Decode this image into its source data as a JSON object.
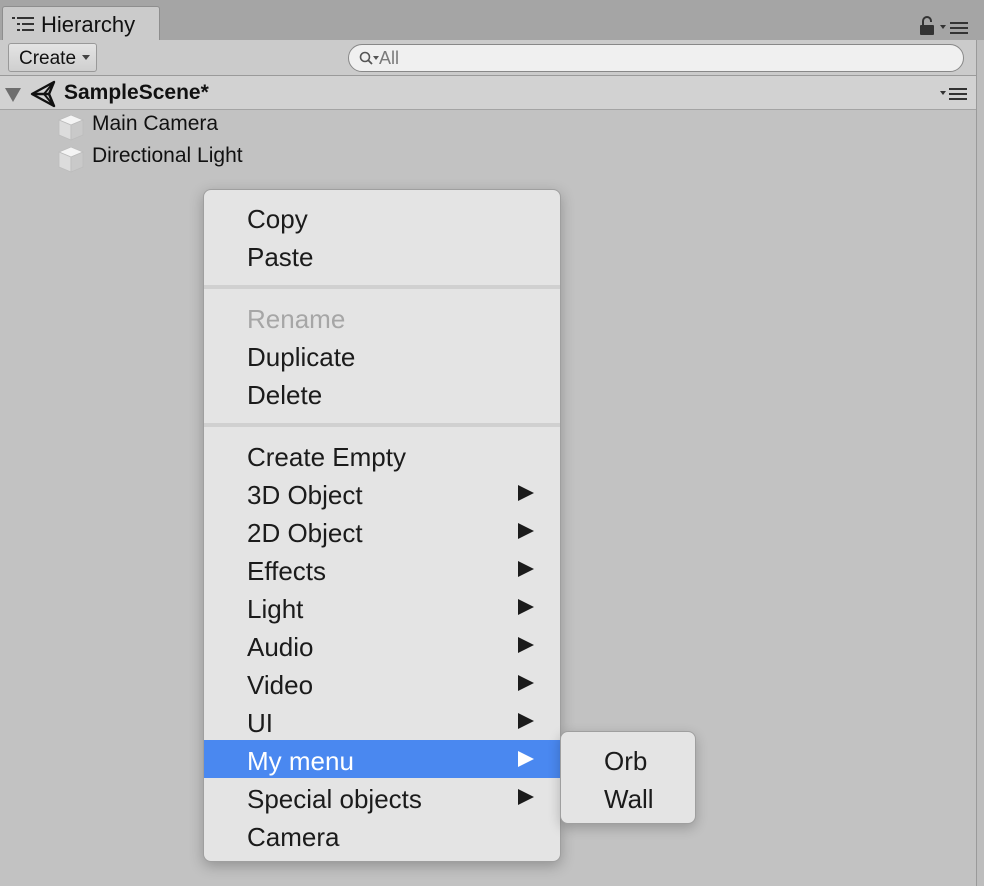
{
  "tab": {
    "title": "Hierarchy",
    "icon": "hierarchy-list-icon"
  },
  "toolbar": {
    "create_label": "Create",
    "search_placeholder": "All"
  },
  "scene": {
    "name": "SampleScene*",
    "icon": "unity-logo-icon"
  },
  "hierarchy": {
    "items": [
      {
        "label": "Main Camera",
        "icon": "gameobject-cube-icon"
      },
      {
        "label": "Directional Light",
        "icon": "gameobject-cube-icon"
      }
    ]
  },
  "context_menu": {
    "groups": [
      [
        {
          "label": "Copy"
        },
        {
          "label": "Paste"
        }
      ],
      [
        {
          "label": "Rename",
          "disabled": true
        },
        {
          "label": "Duplicate"
        },
        {
          "label": "Delete"
        }
      ],
      [
        {
          "label": "Create Empty"
        },
        {
          "label": "3D Object",
          "submenu": true
        },
        {
          "label": "2D Object",
          "submenu": true
        },
        {
          "label": "Effects",
          "submenu": true
        },
        {
          "label": "Light",
          "submenu": true
        },
        {
          "label": "Audio",
          "submenu": true
        },
        {
          "label": "Video",
          "submenu": true
        },
        {
          "label": "UI",
          "submenu": true
        },
        {
          "label": "My menu",
          "submenu": true,
          "highlighted": true
        },
        {
          "label": "Special objects",
          "submenu": true
        },
        {
          "label": "Camera"
        }
      ]
    ]
  },
  "submenu": {
    "items": [
      {
        "label": "Orb"
      },
      {
        "label": "Wall"
      }
    ]
  },
  "colors": {
    "highlight": "#4a88f0",
    "panel": "#c2c2c2",
    "menu": "#e4e4e4"
  }
}
